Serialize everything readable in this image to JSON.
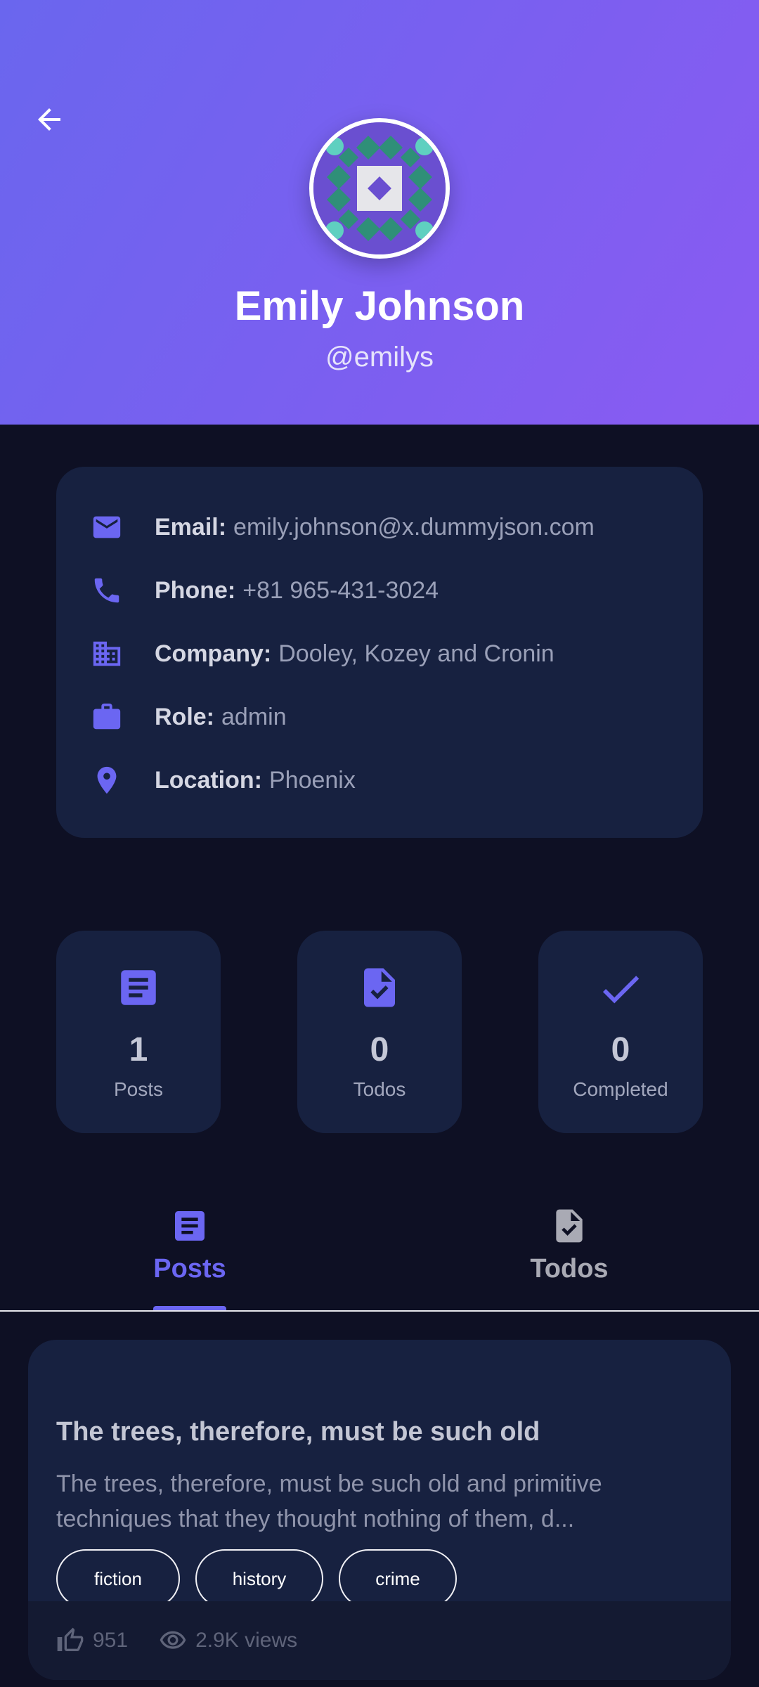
{
  "colors": {
    "accent": "#6b66f2",
    "header_start": "#6a66ee",
    "header_end": "#8a5bf2",
    "background": "#0e1024",
    "card": "#172140"
  },
  "header": {
    "back_icon": "arrow-left-icon",
    "avatar_icon": "identicon-avatar",
    "name": "Emily Johnson",
    "username": "@emilys"
  },
  "info": [
    {
      "icon": "email-icon",
      "label": "Email:",
      "value": "emily.johnson@x.dummyjson.com"
    },
    {
      "icon": "phone-icon",
      "label": "Phone:",
      "value": "+81 965-431-3024"
    },
    {
      "icon": "building-icon",
      "label": "Company:",
      "value": "Dooley, Kozey and Cronin"
    },
    {
      "icon": "briefcase-icon",
      "label": "Role:",
      "value": "admin"
    },
    {
      "icon": "location-pin-icon",
      "label": "Location:",
      "value": "Phoenix"
    }
  ],
  "stats": [
    {
      "icon": "article-icon",
      "value": "1",
      "label": "Posts"
    },
    {
      "icon": "task-document-icon",
      "value": "0",
      "label": "Todos"
    },
    {
      "icon": "check-icon",
      "value": "0",
      "label": "Completed"
    }
  ],
  "tabs": [
    {
      "icon": "article-icon",
      "label": "Posts",
      "active": true
    },
    {
      "icon": "task-document-icon",
      "label": "Todos",
      "active": false
    }
  ],
  "post": {
    "title": "The trees, therefore, must be such old",
    "body": "The trees, therefore, must be such old and primitive techniques that they thought nothing of them, d...",
    "tags": [
      "fiction",
      "history",
      "crime"
    ],
    "likes": "951",
    "views": "2.9K views"
  }
}
